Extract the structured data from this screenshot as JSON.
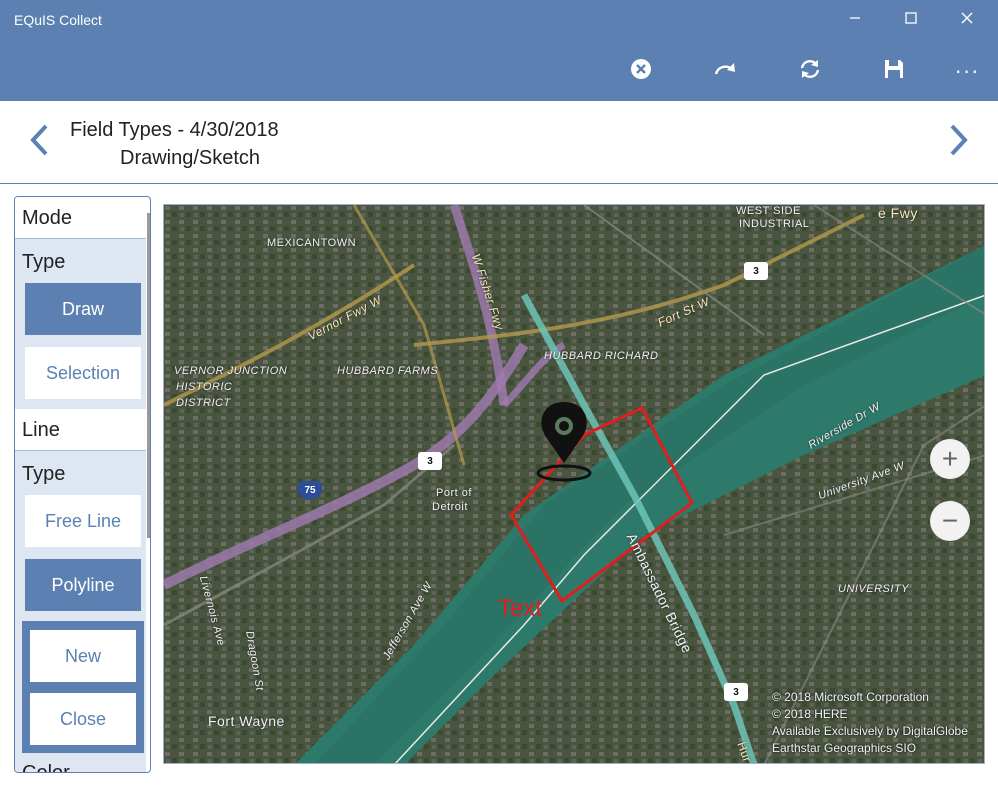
{
  "window": {
    "title": "EQuIS Collect",
    "minimize": "—",
    "maximize": "☐",
    "close": "✕"
  },
  "toolbar": {
    "items": [
      "cancel-icon",
      "redo-icon",
      "sync-icon",
      "save-icon",
      "more-icon"
    ],
    "more": "···"
  },
  "header": {
    "title": "Field Types - 4/30/2018",
    "subtitle": "Drawing/Sketch"
  },
  "panel": {
    "mode_heading": "Mode",
    "type_label": "Type",
    "draw": "Draw",
    "selection": "Selection",
    "line_heading": "Line",
    "line_type_label": "Type",
    "free_line": "Free Line",
    "polyline": "Polyline",
    "new": "New",
    "close": "Close",
    "color_heading": "Color"
  },
  "map": {
    "labels": {
      "mexicantown": "MEXICANTOWN",
      "west_side": "WEST SIDE",
      "industrial": "INDUSTRIAL",
      "vernor": "Vernor Fwy W",
      "w_fisher": "W Fisher Fwy",
      "fort_st": "Fort St W",
      "hubbard_richard": "HUBBARD RICHARD",
      "hubbard_farms": "HUBBARD FARMS",
      "vernor_junction": "VERNOR JUNCTION",
      "historic": "HISTORIC",
      "district": "DISTRICT",
      "port": "Port of",
      "detroit": "Detroit",
      "ambassador": "Ambassador Bridge",
      "riverside": "Riverside Dr W",
      "university_ave": "University Ave W",
      "university": "UNIVERSITY",
      "fort_wayne": "Fort Wayne",
      "jefferson": "Jefferson Ave W",
      "dragoon": "Dragoon St",
      "livernois": "Livernois Ave",
      "lee_fwy": "e Fwy",
      "hur": "Hur"
    },
    "shields": {
      "i75": "75",
      "m3": "3"
    },
    "zoom_in": "+",
    "zoom_out": "−",
    "drawn_text": "Text",
    "copyright": [
      "© 2018 Microsoft Corporation",
      "© 2018 HERE",
      "Available Exclusively by DigitalGlobe",
      "Earthstar Geographics  SIO"
    ]
  },
  "colors": {
    "accent": "#5b80b1",
    "selected_bg": "#5b80b1",
    "panel_bg": "#dde6f1",
    "drawing": "#e21d1d"
  }
}
